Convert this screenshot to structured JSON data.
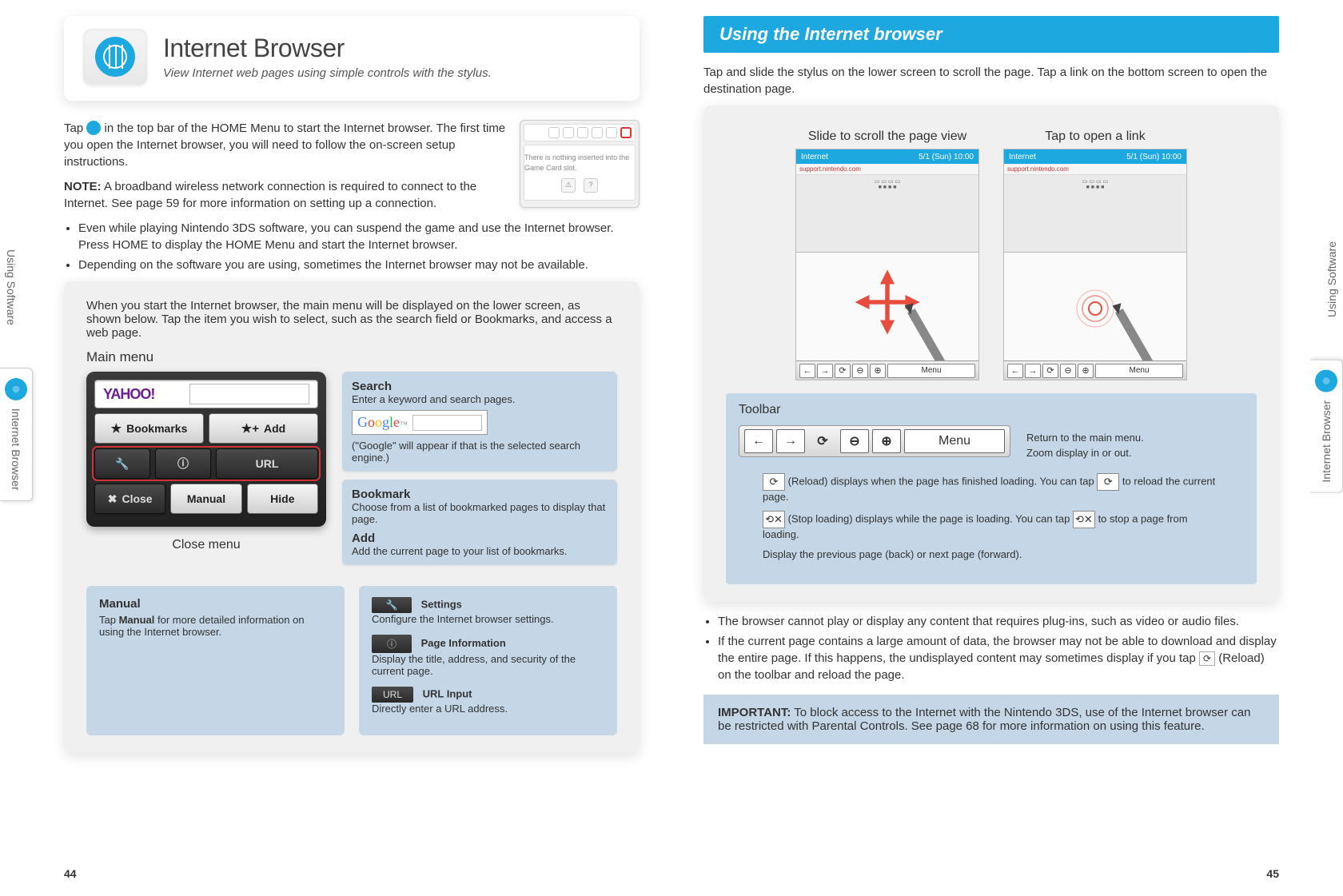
{
  "left": {
    "header": {
      "title": "Internet Browser",
      "subtitle": "View Internet web pages using simple controls with the stylus."
    },
    "intro1a": "Tap ",
    "intro1b": " in the top bar of the HOME Menu to start the Internet browser. The first time you open the Internet browser, you will need to follow the on-screen setup instructions.",
    "noteLabel": "NOTE:",
    "noteText": " A broadband wireless network connection is required to connect to the Internet. See page 59 for more information on setting up a connection.",
    "bullets": [
      "Even while playing Nintendo 3DS software, you can suspend the game and use the Internet browser. Press HOME to display the HOME Menu and start the Internet browser.",
      "Depending on the software you are using, sometimes the Internet browser may not be available."
    ],
    "cardIntro": "When you start the Internet browser, the main menu will be displayed on the lower screen, as shown below. Tap the item you wish to select, such as the search field or Bookmarks, and access a web page.",
    "mainMenu": "Main menu",
    "dsButtons": {
      "yahoo": "YAHOO!",
      "bookmarks": "Bookmarks",
      "add": "Add",
      "settings": "⚒",
      "info": "ⓘ",
      "url": "URL",
      "close": "Close",
      "manual": "Manual",
      "hide": "Hide"
    },
    "closeMenu": "Close menu",
    "search": {
      "t": "Search",
      "d": "Enter a keyword and search pages.",
      "d2": "(\"Google\" will appear if that is the selected search engine.)"
    },
    "bookmark": {
      "t": "Bookmark",
      "d": "Choose from a list of bookmarked pages to display that page."
    },
    "addBox": {
      "t": "Add",
      "d": "Add the current page to your list of bookmarks."
    },
    "manual": {
      "t": "Manual",
      "d1": "Tap ",
      "d2": "Manual",
      "d3": " for more detailed information on using the Internet browser."
    },
    "settings": {
      "t": "Settings",
      "d": "Configure the Internet browser settings."
    },
    "pageInfo": {
      "t": "Page Information",
      "d": "Display the title, address, and security of the current page."
    },
    "urlInput": {
      "t": "URL Input",
      "d": "Directly enter a URL address."
    },
    "sideTabs": {
      "software": "Using Software",
      "browser": "Internet Browser"
    },
    "hs_text": "There is nothing inserted into the Game Card slot."
  },
  "right": {
    "banner": "Using the Internet browser",
    "intro": "Tap and slide the stylus on the lower screen to scroll the page. Tap a link on the bottom screen to open the destination page.",
    "shotLabels": {
      "scroll": "Slide to scroll the page view",
      "tap": "Tap to open a link"
    },
    "screen": {
      "title": "Internet",
      "time": "5/1 (Sun) 10:00",
      "site": "support.nintendo.com",
      "menu": "Menu"
    },
    "toolbar": {
      "label": "Toolbar",
      "menu": "Menu",
      "return": "Return to the main menu.",
      "zoom": "Zoom display in or out.",
      "reload1a": " (Reload) displays when the page has finished loading. You can tap ",
      "reload1b": " to reload the current page.",
      "stop1a": " (Stop loading) displays while the page is loading. You can tap ",
      "stop1b": " to stop a page from loading.",
      "backfwd": "Display the previous page (back) or next page (forward)."
    },
    "bullets": [
      "The browser cannot play or display any content that requires plug-ins, such as video or audio files.",
      "If the current page contains a large amount of data, the browser may not be able to download and display the entire page. If this happens, the undisplayed content may sometimes display if you tap   (Reload) on the toolbar and reload the page."
    ],
    "bullet2a": "If the current page contains a large amount of data, the browser may not be able to download and display the entire page. If this happens, the undisplayed content may sometimes display if you tap ",
    "bullet2b": " (Reload) on the toolbar and reload the page.",
    "important": {
      "label": "IMPORTANT:",
      "text": " To block access to the Internet with the Nintendo 3DS, use of the Internet browser can be restricted with Parental Controls. See page 68 for more information on using this feature."
    },
    "sideTabs": {
      "software": "Using Software",
      "browser": "Internet Browser"
    }
  },
  "pageNums": {
    "left": "44",
    "right": "45"
  }
}
